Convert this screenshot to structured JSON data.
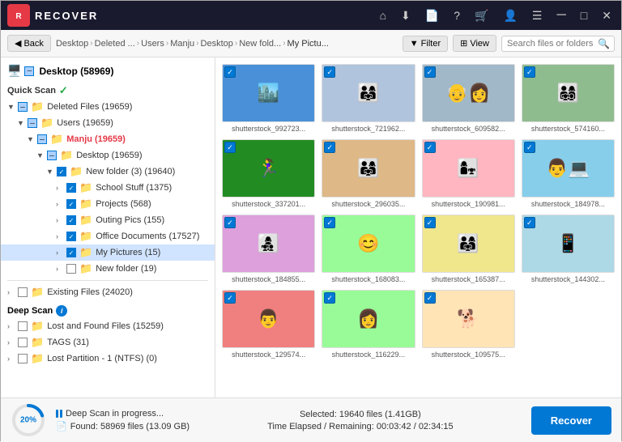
{
  "app": {
    "name": "RECOVER",
    "logo_text": "R"
  },
  "titlebar": {
    "icons": [
      "home",
      "download",
      "file",
      "help",
      "cart",
      "user",
      "menu",
      "minimize",
      "maximize",
      "close"
    ]
  },
  "toolbar": {
    "back_label": "Back",
    "breadcrumb": [
      {
        "label": "Desktop",
        "current": false
      },
      {
        "label": "Deleted ...",
        "current": false
      },
      {
        "label": "Users",
        "current": false
      },
      {
        "label": "Manju",
        "current": false
      },
      {
        "label": "Desktop",
        "current": false
      },
      {
        "label": "New fold...",
        "current": false
      },
      {
        "label": "My Pictu...",
        "current": true
      }
    ],
    "filter_label": "Filter",
    "view_label": "View",
    "search_placeholder": "Search files or folders"
  },
  "sidebar": {
    "root_label": "Desktop (58969)",
    "quick_scan_label": "Quick Scan",
    "check_mark": "✓",
    "tree": [
      {
        "id": "deleted-files",
        "label": "Deleted Files (19659)",
        "indent": 1,
        "arrow": "▼",
        "cb": "partial",
        "type": "folder"
      },
      {
        "id": "users",
        "label": "Users (19659)",
        "indent": 2,
        "arrow": "▼",
        "cb": "partial",
        "type": "folder"
      },
      {
        "id": "manju",
        "label": "Manju (19659)",
        "indent": 3,
        "arrow": "▼",
        "cb": "partial",
        "type": "folder",
        "highlight": true
      },
      {
        "id": "desktop",
        "label": "Desktop (19659)",
        "indent": 4,
        "arrow": "▼",
        "cb": "partial",
        "type": "folder"
      },
      {
        "id": "new-folder-3",
        "label": "New folder (3) (19640)",
        "indent": 5,
        "arrow": "▼",
        "cb": "checked",
        "type": "folder"
      },
      {
        "id": "school-stuff",
        "label": "School Stuff (1375)",
        "indent": 6,
        "arrow": ">",
        "cb": "checked",
        "type": "folder"
      },
      {
        "id": "projects",
        "label": "Projects (568)",
        "indent": 6,
        "arrow": ">",
        "cb": "checked",
        "type": "folder"
      },
      {
        "id": "outing-pics",
        "label": "Outing Pics (155)",
        "indent": 6,
        "arrow": ">",
        "cb": "checked",
        "type": "folder"
      },
      {
        "id": "office-docs",
        "label": "Office Documents (17527)",
        "indent": 6,
        "arrow": ">",
        "cb": "checked",
        "type": "folder"
      },
      {
        "id": "my-pictures",
        "label": "My Pictures (15)",
        "indent": 6,
        "arrow": ">",
        "cb": "checked",
        "type": "folder",
        "selected": true
      },
      {
        "id": "new-folder",
        "label": "New folder (19)",
        "indent": 6,
        "arrow": ">",
        "cb": "unchecked",
        "type": "folder"
      }
    ],
    "existing_files_label": "Existing Files (24020)",
    "deep_scan_label": "Deep Scan",
    "deep_tree": [
      {
        "id": "lost-found",
        "label": "Lost and Found Files (15259)",
        "indent": 1,
        "arrow": ">",
        "cb": "unchecked",
        "type": "folder"
      },
      {
        "id": "tags",
        "label": "TAGS (31)",
        "indent": 1,
        "arrow": ">",
        "cb": "unchecked",
        "type": "folder"
      },
      {
        "id": "lost-partition",
        "label": "Lost Partition - 1 (NTFS) (0)",
        "indent": 1,
        "arrow": ">",
        "cb": "unchecked",
        "type": "folder"
      }
    ]
  },
  "thumbnails": [
    {
      "id": 1,
      "label": "shutterstock_992723...",
      "photo_class": "photo-1",
      "emoji": "🏙️"
    },
    {
      "id": 2,
      "label": "shutterstock_721962...",
      "photo_class": "photo-2",
      "emoji": "👨‍👩‍👧"
    },
    {
      "id": 3,
      "label": "shutterstock_609582...",
      "photo_class": "photo-3",
      "emoji": "👴👩"
    },
    {
      "id": 4,
      "label": "shutterstock_574160...",
      "photo_class": "photo-4",
      "emoji": "👨‍👩‍👧‍👦"
    },
    {
      "id": 5,
      "label": "shutterstock_337201...",
      "photo_class": "photo-5",
      "emoji": "🏃‍♀️"
    },
    {
      "id": 6,
      "label": "shutterstock_296035...",
      "photo_class": "photo-6",
      "emoji": "👨‍👩‍👧"
    },
    {
      "id": 7,
      "label": "shutterstock_190981...",
      "photo_class": "photo-7",
      "emoji": "👩‍👧"
    },
    {
      "id": 8,
      "label": "shutterstock_184978...",
      "photo_class": "photo-8",
      "emoji": "👨💻"
    },
    {
      "id": 9,
      "label": "shutterstock_184855...",
      "photo_class": "photo-9",
      "emoji": "👩‍👧‍👦"
    },
    {
      "id": 10,
      "label": "shutterstock_168083...",
      "photo_class": "photo-10",
      "emoji": "😊"
    },
    {
      "id": 11,
      "label": "shutterstock_165387...",
      "photo_class": "photo-11",
      "emoji": "👨‍👩‍👧"
    },
    {
      "id": 12,
      "label": "shutterstock_144302...",
      "photo_class": "photo-12",
      "emoji": "📱"
    },
    {
      "id": 13,
      "label": "shutterstock_129574...",
      "photo_class": "photo-13",
      "emoji": "👨"
    },
    {
      "id": 14,
      "label": "shutterstock_116229...",
      "photo_class": "photo-14",
      "emoji": "👩"
    },
    {
      "id": 15,
      "label": "shutterstock_109575...",
      "photo_class": "photo-15",
      "emoji": "🐕"
    }
  ],
  "statusbar": {
    "progress_percent": "20%",
    "progress_value": 20,
    "scan_status": "Deep Scan in progress...",
    "found_label": "Found: 58969 files (13.09 GB)",
    "selected_label": "Selected: 19640 files (1.41GB)",
    "elapsed_label": "Time Elapsed / Remaining: 00:03:42 / 02:34:15",
    "recover_label": "Recover"
  }
}
